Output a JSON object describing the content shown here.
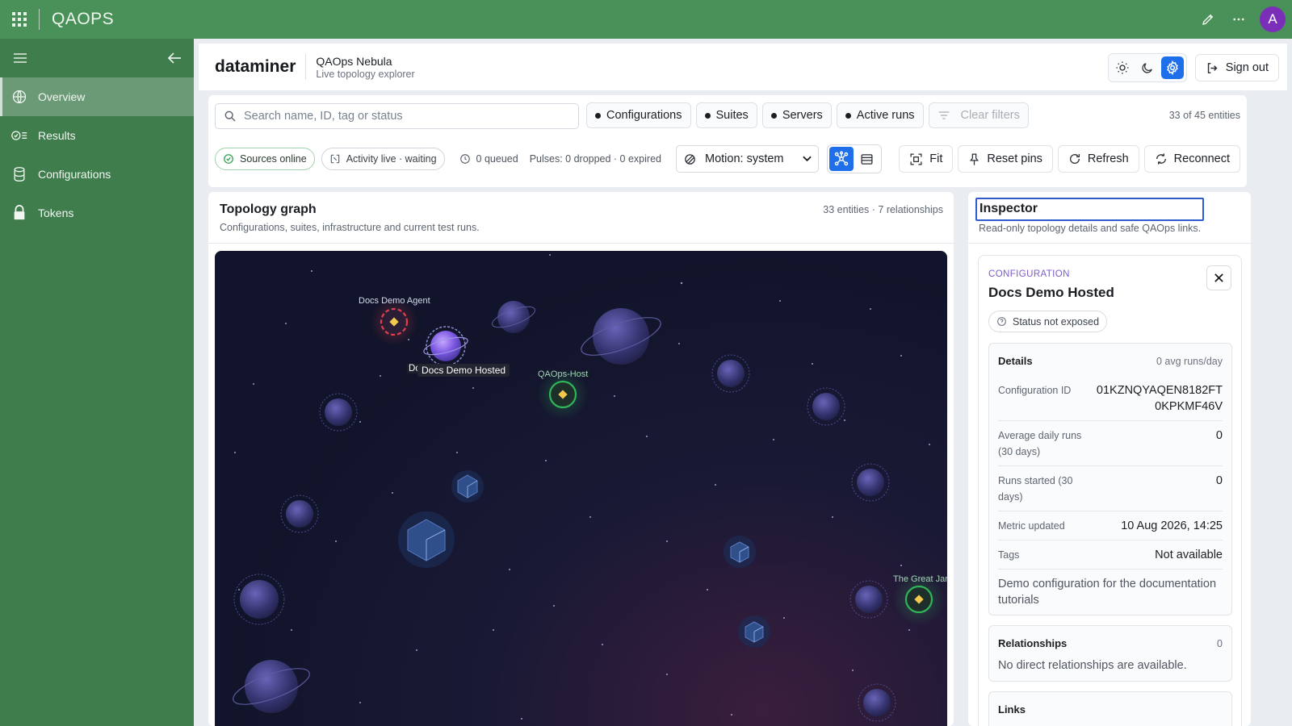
{
  "topbar": {
    "brand": "QAOPS",
    "avatar_letter": "A"
  },
  "sidebar": {
    "items": [
      {
        "label": "Overview",
        "icon": "globe-icon",
        "active": true
      },
      {
        "label": "Results",
        "icon": "results-icon",
        "active": false
      },
      {
        "label": "Configurations",
        "icon": "database-icon",
        "active": false
      },
      {
        "label": "Tokens",
        "icon": "lock-icon",
        "active": false
      }
    ]
  },
  "header": {
    "title": "dataminer",
    "app_title": "QAOps Nebula",
    "app_subtitle": "Live topology explorer",
    "sign_out": "Sign out"
  },
  "filters": {
    "search_placeholder": "Search name, ID, tag or status",
    "chips": [
      "Configurations",
      "Suites",
      "Servers",
      "Active runs"
    ],
    "clear_filters": "Clear filters",
    "entity_count": "33 of 45 entities"
  },
  "status_bar": {
    "sources": "Sources online",
    "activity": "Activity live · waiting",
    "queued": "0 queued",
    "pulses": "Pulses: 0 dropped · 0 expired",
    "motion": "Motion: system",
    "fit": "Fit",
    "reset_pins": "Reset pins",
    "refresh": "Refresh",
    "reconnect": "Reconnect"
  },
  "topology": {
    "title": "Topology graph",
    "subtitle": "Configurations, suites, infrastructure and current test runs.",
    "count": "33 entities · 7 relationships",
    "labels": {
      "agent": "Docs Demo Agent",
      "host": "QAOps-Host",
      "hosted_tooltip": "Docs Demo Hosted",
      "hosted_partial": "Do",
      "great": "The Great Jar"
    }
  },
  "inspector": {
    "title": "Inspector",
    "subtitle": "Read-only topology details and safe QAOps links.",
    "kind": "CONFIGURATION",
    "name": "Docs Demo Hosted",
    "status": "Status not exposed",
    "details_label": "Details",
    "details_sub": "0 avg runs/day",
    "rows": [
      {
        "k": "Configuration ID",
        "v": "01KZNQYAQEN8182FT0KPKMF46V"
      },
      {
        "k": "Average daily runs (30 days)",
        "v": "0"
      },
      {
        "k": "Runs started (30 days)",
        "v": "0"
      },
      {
        "k": "Metric updated",
        "v": "10 Aug 2026, 14:25"
      },
      {
        "k": "Tags",
        "v": "Not available"
      }
    ],
    "description": "Demo configuration for the documentation tutorials",
    "relationships_label": "Relationships",
    "relationships_count": "0",
    "relationships_empty": "No direct relationships are available.",
    "links_label": "Links"
  },
  "colors": {
    "topbar": "#4a9159",
    "sidebar": "#3f7d4d",
    "accent": "#1f6feb",
    "canvas": "#11142a",
    "planet": "#3d3d7a",
    "ok_ring": "#2fb457",
    "error_ring": "#e0414d",
    "diamond": "#f2c94c"
  }
}
